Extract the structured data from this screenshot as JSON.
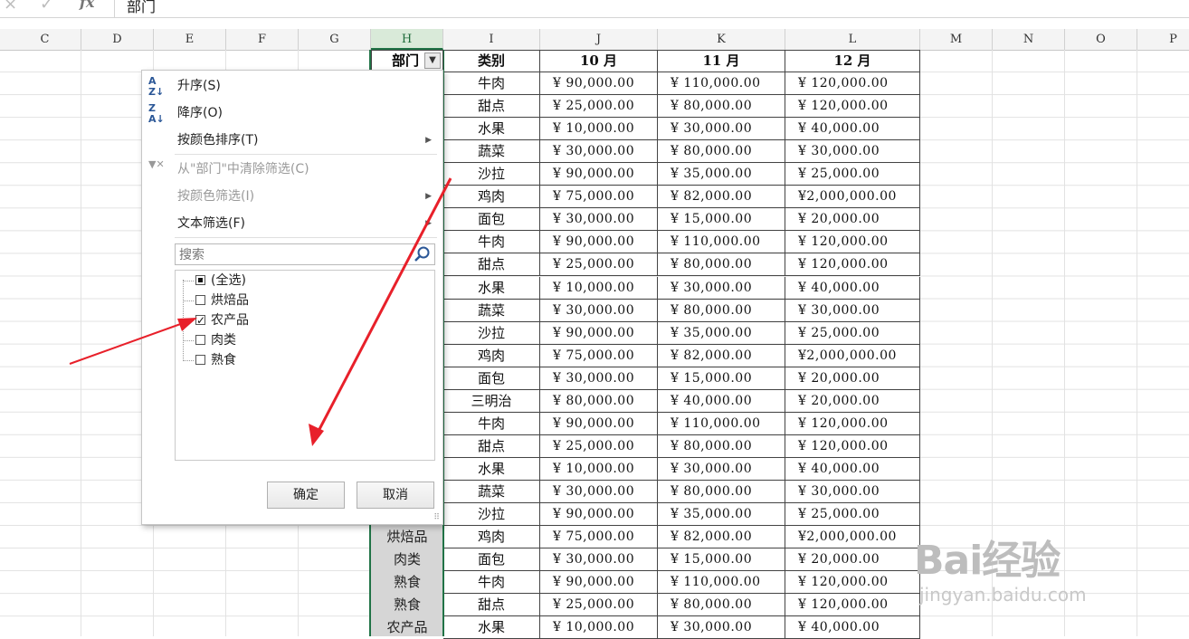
{
  "formula_bar": {
    "cancel_icon": "×",
    "enter_icon": "✓",
    "fx_label": "fx",
    "content": "部门"
  },
  "columns": [
    "C",
    "D",
    "E",
    "F",
    "G",
    "H",
    "I",
    "J",
    "K",
    "L",
    "M",
    "N",
    "O",
    "P"
  ],
  "table": {
    "dept_header": "部门",
    "headers": [
      "类别",
      "10 月",
      "11 月",
      "12 月"
    ],
    "rows": [
      {
        "dept": "",
        "cat": "牛肉",
        "oct": "¥  90,000.00",
        "nov": "¥  110,000.00",
        "dec": "¥   120,000.00"
      },
      {
        "dept": "",
        "cat": "甜点",
        "oct": "¥  25,000.00",
        "nov": "¥   80,000.00",
        "dec": "¥   120,000.00"
      },
      {
        "dept": "",
        "cat": "水果",
        "oct": "¥  10,000.00",
        "nov": "¥   30,000.00",
        "dec": "¥    40,000.00"
      },
      {
        "dept": "",
        "cat": "蔬菜",
        "oct": "¥  30,000.00",
        "nov": "¥   80,000.00",
        "dec": "¥    30,000.00"
      },
      {
        "dept": "",
        "cat": "沙拉",
        "oct": "¥  90,000.00",
        "nov": "¥   35,000.00",
        "dec": "¥    25,000.00"
      },
      {
        "dept": "",
        "cat": "鸡肉",
        "oct": "¥  75,000.00",
        "nov": "¥   82,000.00",
        "dec": "¥2,000,000.00"
      },
      {
        "dept": "",
        "cat": "面包",
        "oct": "¥  30,000.00",
        "nov": "¥   15,000.00",
        "dec": "¥    20,000.00"
      },
      {
        "dept": "",
        "cat": "牛肉",
        "oct": "¥  90,000.00",
        "nov": "¥  110,000.00",
        "dec": "¥   120,000.00"
      },
      {
        "dept": "",
        "cat": "甜点",
        "oct": "¥  25,000.00",
        "nov": "¥   80,000.00",
        "dec": "¥   120,000.00"
      },
      {
        "dept": "",
        "cat": "水果",
        "oct": "¥  10,000.00",
        "nov": "¥   30,000.00",
        "dec": "¥    40,000.00"
      },
      {
        "dept": "",
        "cat": "蔬菜",
        "oct": "¥  30,000.00",
        "nov": "¥   80,000.00",
        "dec": "¥    30,000.00"
      },
      {
        "dept": "",
        "cat": "沙拉",
        "oct": "¥  90,000.00",
        "nov": "¥   35,000.00",
        "dec": "¥    25,000.00"
      },
      {
        "dept": "",
        "cat": "鸡肉",
        "oct": "¥  75,000.00",
        "nov": "¥   82,000.00",
        "dec": "¥2,000,000.00"
      },
      {
        "dept": "",
        "cat": "面包",
        "oct": "¥  30,000.00",
        "nov": "¥   15,000.00",
        "dec": "¥    20,000.00"
      },
      {
        "dept": "",
        "cat": "三明治",
        "oct": "¥  80,000.00",
        "nov": "¥   40,000.00",
        "dec": "¥    20,000.00"
      },
      {
        "dept": "",
        "cat": "牛肉",
        "oct": "¥  90,000.00",
        "nov": "¥  110,000.00",
        "dec": "¥   120,000.00"
      },
      {
        "dept": "",
        "cat": "甜点",
        "oct": "¥  25,000.00",
        "nov": "¥   80,000.00",
        "dec": "¥   120,000.00"
      },
      {
        "dept": "",
        "cat": "水果",
        "oct": "¥  10,000.00",
        "nov": "¥   30,000.00",
        "dec": "¥    40,000.00"
      },
      {
        "dept": "",
        "cat": "蔬菜",
        "oct": "¥  30,000.00",
        "nov": "¥   80,000.00",
        "dec": "¥    30,000.00"
      },
      {
        "dept": "",
        "cat": "沙拉",
        "oct": "¥  90,000.00",
        "nov": "¥   35,000.00",
        "dec": "¥    25,000.00"
      },
      {
        "dept": "烘焙品",
        "cat": "鸡肉",
        "oct": "¥  75,000.00",
        "nov": "¥   82,000.00",
        "dec": "¥2,000,000.00"
      },
      {
        "dept": "肉类",
        "cat": "面包",
        "oct": "¥  30,000.00",
        "nov": "¥   15,000.00",
        "dec": "¥    20,000.00"
      },
      {
        "dept": "熟食",
        "cat": "牛肉",
        "oct": "¥  90,000.00",
        "nov": "¥  110,000.00",
        "dec": "¥   120,000.00"
      },
      {
        "dept": "熟食",
        "cat": "甜点",
        "oct": "¥  25,000.00",
        "nov": "¥   80,000.00",
        "dec": "¥   120,000.00"
      },
      {
        "dept": "农产品",
        "cat": "水果",
        "oct": "¥  10,000.00",
        "nov": "¥   30,000.00",
        "dec": "¥    40,000.00"
      }
    ]
  },
  "filter_menu": {
    "sort_asc": "升序(S)",
    "sort_desc": "降序(O)",
    "sort_by_color": "按颜色排序(T)",
    "clear_filter": "从\"部门\"中清除筛选(C)",
    "filter_by_color": "按颜色筛选(I)",
    "text_filter": "文本筛选(F)",
    "search_placeholder": "搜索",
    "items": [
      {
        "label": "(全选)",
        "state": "partial"
      },
      {
        "label": "烘焙品",
        "state": "unchecked"
      },
      {
        "label": "农产品",
        "state": "checked"
      },
      {
        "label": "肉类",
        "state": "unchecked"
      },
      {
        "label": "熟食",
        "state": "unchecked"
      }
    ],
    "ok_label": "确定",
    "cancel_label": "取消"
  },
  "watermark": {
    "brand": "Bai经验",
    "url": "jingyan.baidu.com"
  },
  "colors": {
    "selection_green": "#217346",
    "annotation_red": "#e8202a",
    "dept_fill": "#d6d6d6"
  }
}
